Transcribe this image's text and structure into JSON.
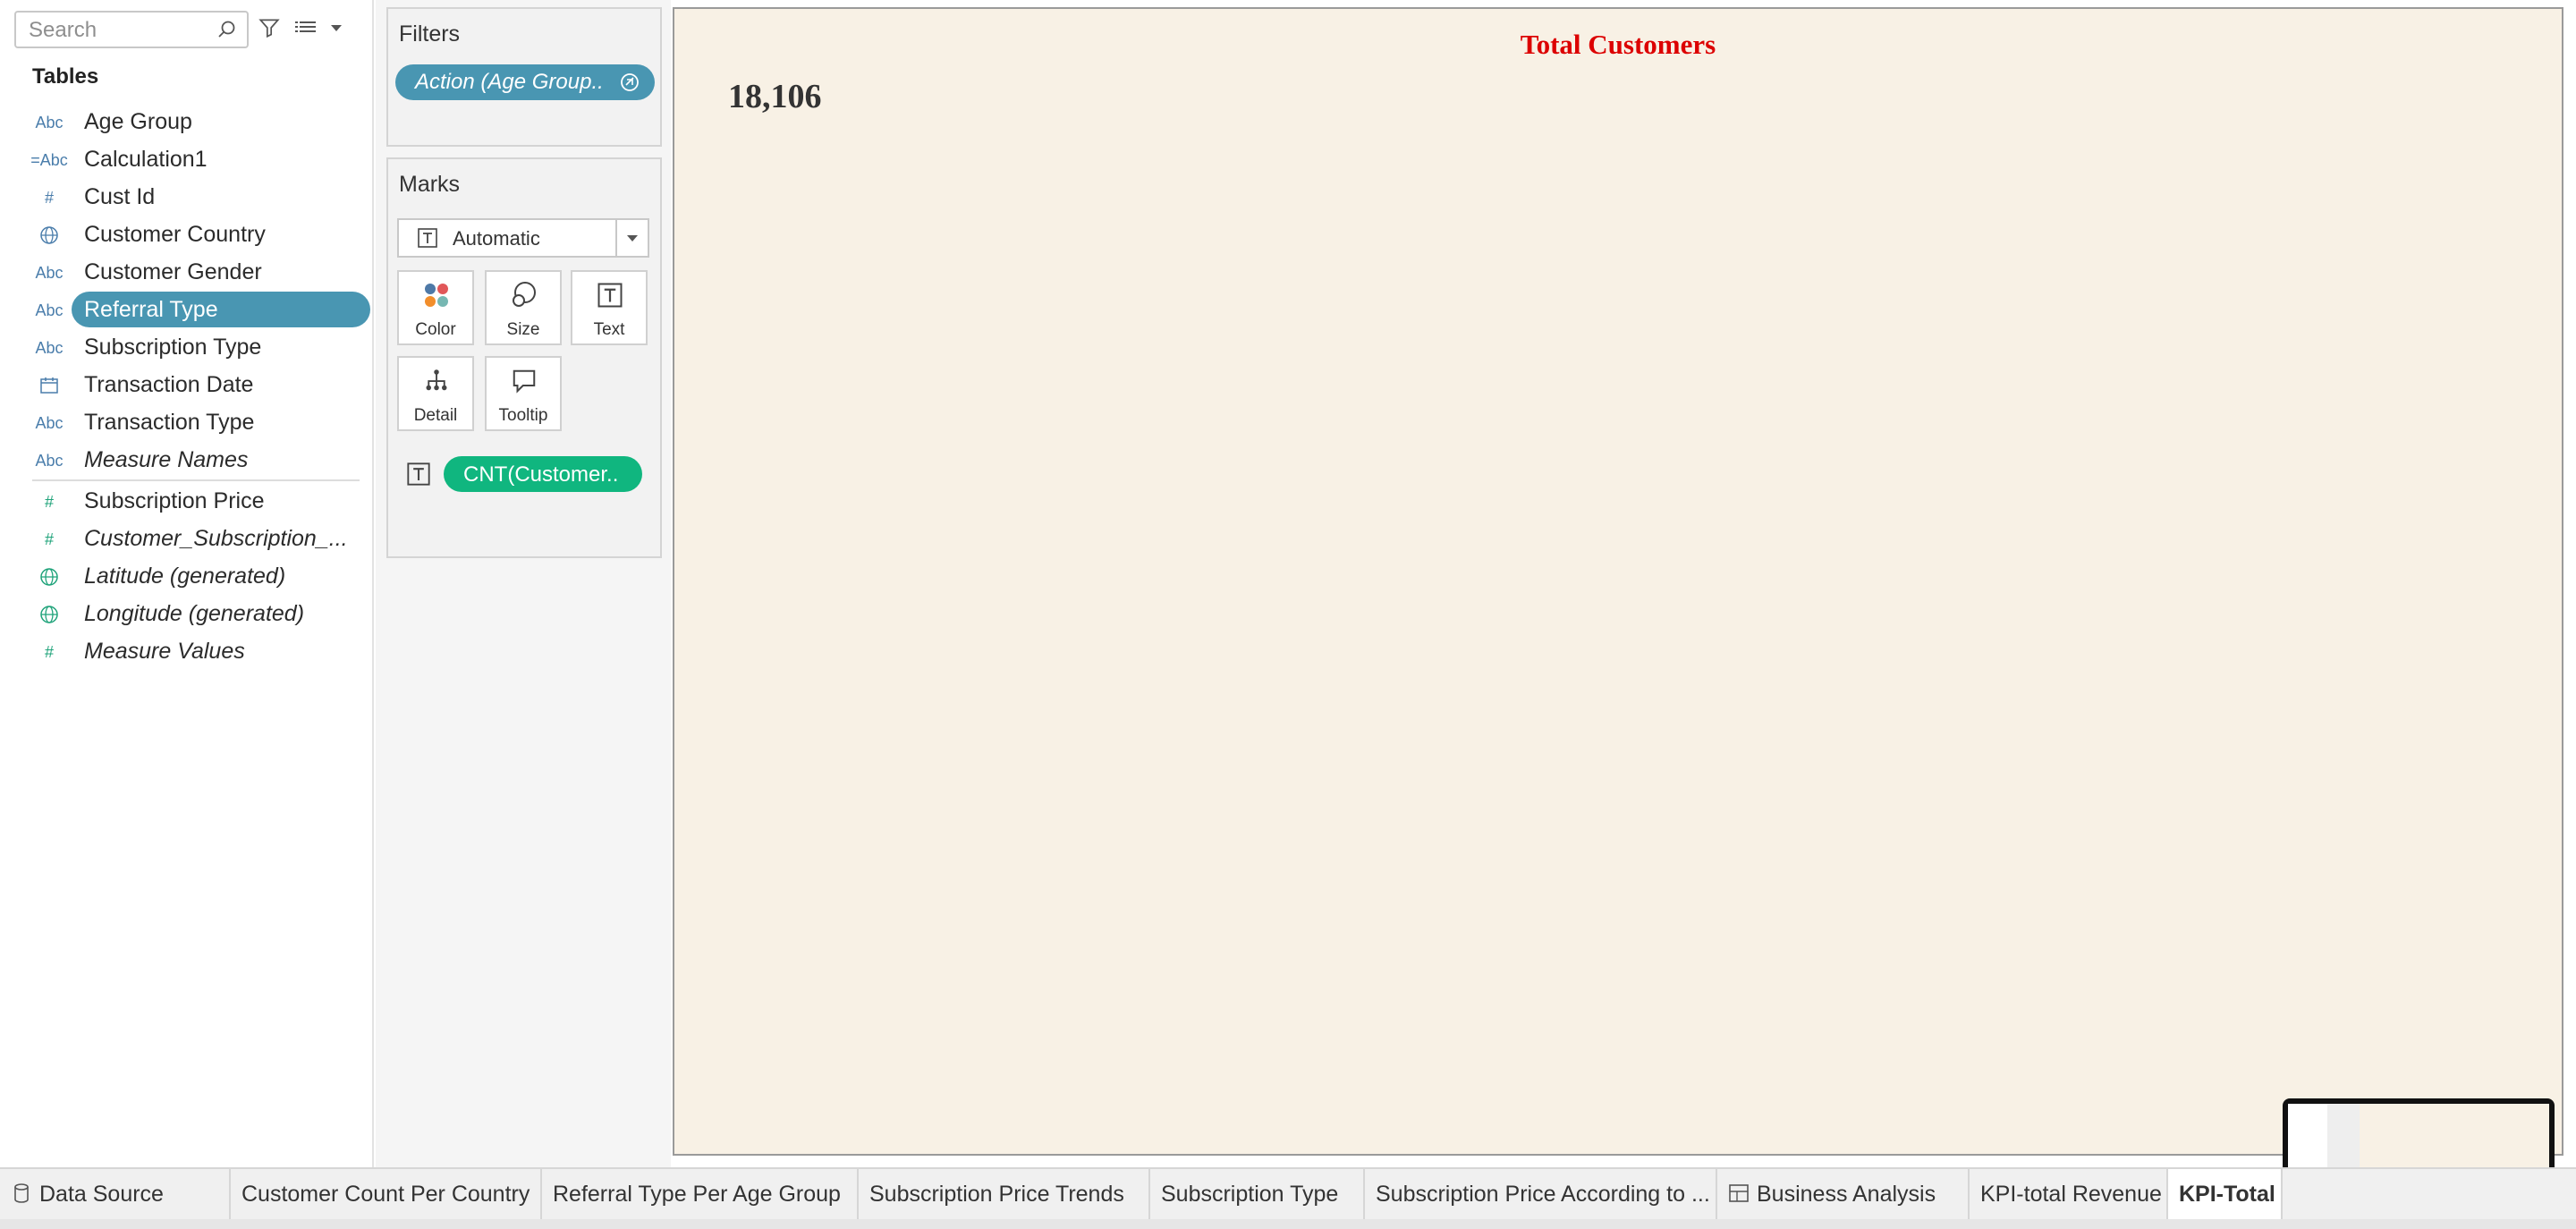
{
  "data_pane": {
    "search_placeholder": "Search",
    "tables_heading": "Tables",
    "fields": [
      {
        "icon": "Abc",
        "label": "Age Group",
        "italic": false
      },
      {
        "icon": "=Abc",
        "label": "Calculation1",
        "italic": false
      },
      {
        "icon": "#",
        "label": "Cust Id",
        "italic": false
      },
      {
        "icon": "globe",
        "label": "Customer Country",
        "italic": false
      },
      {
        "icon": "Abc",
        "label": "Customer Gender",
        "italic": false
      },
      {
        "icon": "Abc",
        "label": "Referral Type",
        "italic": false,
        "selected": true
      },
      {
        "icon": "Abc",
        "label": "Subscription Type",
        "italic": false
      },
      {
        "icon": "calendar",
        "label": "Transaction Date",
        "italic": false
      },
      {
        "icon": "Abc",
        "label": "Transaction Type",
        "italic": false
      },
      {
        "icon": "Abc",
        "label": "Measure Names",
        "italic": true
      }
    ],
    "measures": [
      {
        "icon": "#",
        "label": "Subscription Price",
        "italic": false
      },
      {
        "icon": "#",
        "label": "Customer_Subscription_...",
        "italic": true
      },
      {
        "icon": "globe",
        "label": "Latitude (generated)",
        "italic": true
      },
      {
        "icon": "globe",
        "label": "Longitude (generated)",
        "italic": true
      },
      {
        "icon": "#",
        "label": "Measure Values",
        "italic": true
      }
    ]
  },
  "filters": {
    "title": "Filters",
    "pill": "Action (Age Group.."
  },
  "marks": {
    "title": "Marks",
    "mark_type": "Automatic",
    "buttons": {
      "color": "Color",
      "size": "Size",
      "text": "Text",
      "detail": "Detail",
      "tooltip": "Tooltip"
    },
    "text_pill": "CNT(Customer.."
  },
  "canvas": {
    "title": "Total Customers",
    "kpi_value": "18,106",
    "background": "#f8f1e5",
    "title_color": "#dc0000"
  },
  "tabs": [
    {
      "label": "Data Source",
      "icon": "database-icon"
    },
    {
      "label": "Customer Count Per Country"
    },
    {
      "label": "Referral Type Per Age Group"
    },
    {
      "label": "Subscription Price Trends"
    },
    {
      "label": "Subscription Type"
    },
    {
      "label": "Subscription Price According to ..."
    },
    {
      "label": "Business Analysis",
      "icon": "dashboard-icon"
    },
    {
      "label": "KPI-total Revenue"
    },
    {
      "label": "KPI-Total C",
      "active": true
    }
  ],
  "colors": {
    "accent_blue": "#4996b2",
    "measure_green": "#10b67f"
  }
}
